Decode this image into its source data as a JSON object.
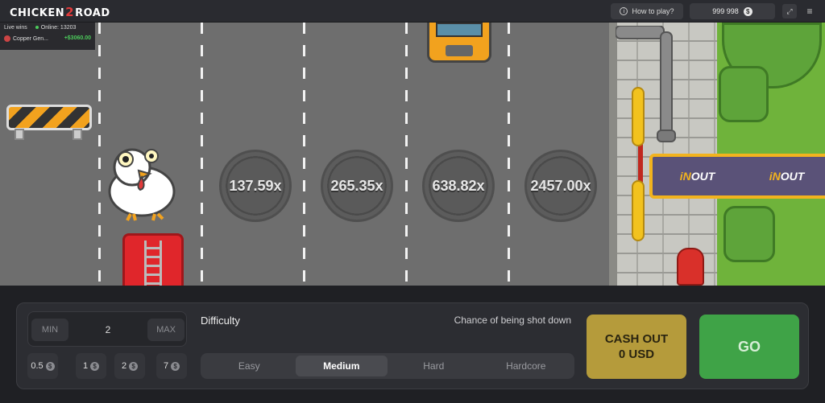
{
  "header": {
    "logo_left": "CHICKEN",
    "logo_mid": "2",
    "logo_right": "ROAD",
    "how_to_play": "How to play?",
    "balance": "999 998",
    "currency_symbol": "$"
  },
  "live_wins": {
    "title": "Live wins",
    "online": "Online: 13203",
    "entries": [
      {
        "user": "Copper Gen...",
        "amount": "+$3060.00"
      }
    ]
  },
  "multipliers": [
    "137.59x",
    "265.35x",
    "638.82x",
    "2457.00x"
  ],
  "scenery": {
    "sign_left": "OUT",
    "sign_right": "OUT",
    "sign_in": "iN"
  },
  "controls": {
    "bet_min": "MIN",
    "bet_value": "2",
    "bet_max": "MAX",
    "quick_bets": [
      "0.5",
      "1",
      "2",
      "7"
    ],
    "difficulty_label": "Difficulty",
    "chance_label": "Chance of being shot down",
    "difficulties": [
      "Easy",
      "Medium",
      "Hard",
      "Hardcore"
    ],
    "selected_difficulty": "Medium",
    "cashout_line1": "CASH OUT",
    "cashout_line2": "0 USD",
    "go": "GO"
  },
  "colors": {
    "go": "#3fa347",
    "cashout": "#b59b3b",
    "win_amount": "#4ccb5b",
    "road": "#6e6e6e"
  }
}
